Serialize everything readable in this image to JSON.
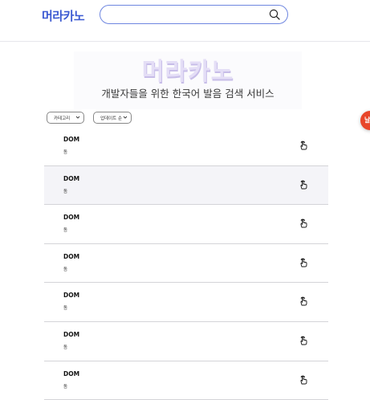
{
  "header": {
    "logo": "머라카노",
    "search": {
      "value": "",
      "placeholder": ""
    }
  },
  "hero": {
    "title": "머라카노",
    "subtitle": "개발자들을 위한 한국어 발음 검색 서비스"
  },
  "filters": {
    "category": "카테고리",
    "sort": "업데이트 순"
  },
  "side_tab": {
    "label": "날"
  },
  "results": [
    {
      "term": "DOM",
      "pronunciation": "돔"
    },
    {
      "term": "DOM",
      "pronunciation": "돔"
    },
    {
      "term": "DOM",
      "pronunciation": "돔"
    },
    {
      "term": "DOM",
      "pronunciation": "돔"
    },
    {
      "term": "DOM",
      "pronunciation": "돔"
    },
    {
      "term": "DOM",
      "pronunciation": "돔"
    },
    {
      "term": "DOM",
      "pronunciation": "돔"
    }
  ],
  "colors": {
    "brand": "#3c5ad2",
    "hover_row": "#f4f4f8",
    "side_tab": "#e8462a"
  },
  "icons": {
    "search": "search-icon",
    "speak": "tap-hand-icon",
    "dropdown": "chevron-down-icon"
  }
}
